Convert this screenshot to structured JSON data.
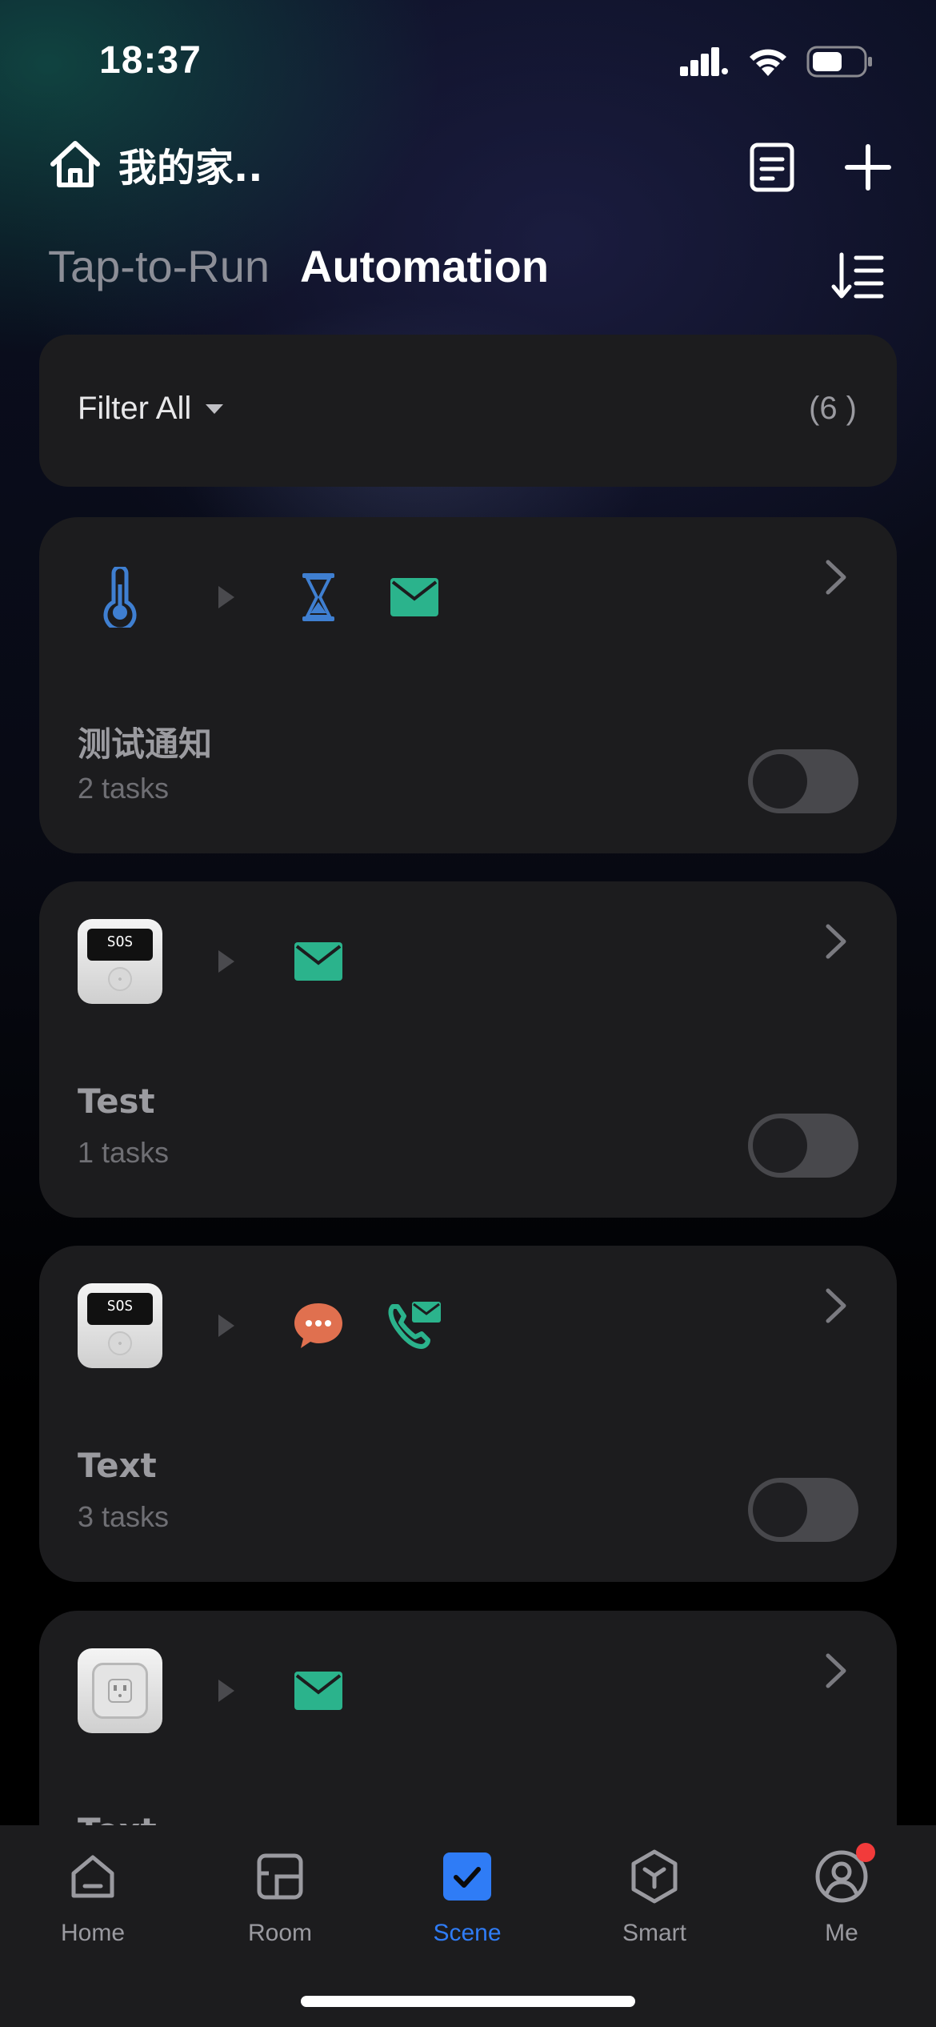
{
  "status_bar": {
    "time": "18:37"
  },
  "header": {
    "home_title": "我的家.."
  },
  "tabs": [
    {
      "label": "Tap-to-Run",
      "active": false
    },
    {
      "label": "Automation",
      "active": true
    }
  ],
  "filter": {
    "label": "Filter All",
    "count": "(6 )"
  },
  "automations": [
    {
      "name": "测试通知",
      "tasks": "2 tasks",
      "enabled": false,
      "trigger_icon": "thermometer-icon",
      "actions": [
        "hourglass-icon",
        "mail-icon"
      ]
    },
    {
      "name": "Test",
      "tasks": "1 tasks",
      "enabled": false,
      "trigger_icon": "sos-device-icon",
      "actions": [
        "mail-icon"
      ]
    },
    {
      "name": "Text",
      "tasks": "3 tasks",
      "enabled": false,
      "trigger_icon": "sos-device-icon",
      "actions": [
        "chat-bubble-icon",
        "phone-mail-icon"
      ]
    },
    {
      "name": "Text",
      "tasks": "",
      "enabled": false,
      "trigger_icon": "smart-plug-icon",
      "actions": [
        "mail-icon"
      ]
    }
  ],
  "device_labels": {
    "sos": "SOS"
  },
  "tab_bar": [
    {
      "label": "Home",
      "icon": "home-icon",
      "active": false
    },
    {
      "label": "Room",
      "icon": "room-icon",
      "active": false
    },
    {
      "label": "Scene",
      "icon": "scene-icon",
      "active": true
    },
    {
      "label": "Smart",
      "icon": "smart-icon",
      "active": false
    },
    {
      "label": "Me",
      "icon": "profile-icon",
      "active": false,
      "badge": true
    }
  ],
  "colors": {
    "accent": "#2f7cf6",
    "mail": "#2bb38c",
    "chat": "#e0704f",
    "thermo": "#3f7fd1",
    "badge": "#f23b3b"
  }
}
